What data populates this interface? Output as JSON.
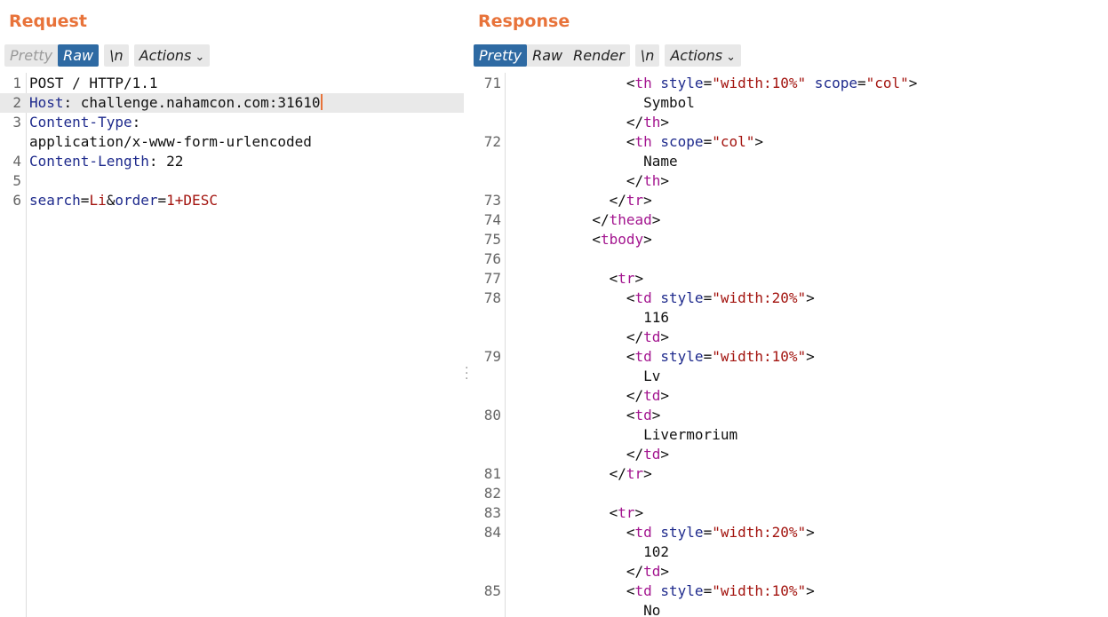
{
  "request": {
    "title": "Request",
    "toolbar": {
      "pretty": "Pretty",
      "raw": "Raw",
      "newline": "\\n",
      "actions": "Actions",
      "active": "raw"
    },
    "lines": [
      {
        "n": "1",
        "tokens": [
          {
            "t": "POST / HTTP/1.1",
            "c": "val"
          }
        ]
      },
      {
        "n": "2",
        "highlight": true,
        "caret": true,
        "tokens": [
          {
            "t": "Host",
            "c": "key"
          },
          {
            "t": ": challenge.nahamcon.com:31610",
            "c": "val"
          }
        ]
      },
      {
        "n": "3",
        "tokens": [
          {
            "t": "Content-Type",
            "c": "key"
          },
          {
            "t": ":",
            "c": "val"
          }
        ]
      },
      {
        "n": "",
        "tokens": [
          {
            "t": "application/x-www-form-urlencoded",
            "c": "val"
          }
        ]
      },
      {
        "n": "4",
        "tokens": [
          {
            "t": "Content-Length",
            "c": "key"
          },
          {
            "t": ": 22",
            "c": "val"
          }
        ]
      },
      {
        "n": "5",
        "tokens": []
      },
      {
        "n": "6",
        "tokens": [
          {
            "t": "search",
            "c": "key"
          },
          {
            "t": "=",
            "c": "val"
          },
          {
            "t": "Li",
            "c": "str"
          },
          {
            "t": "&",
            "c": "val"
          },
          {
            "t": "order",
            "c": "key"
          },
          {
            "t": "=",
            "c": "val"
          },
          {
            "t": "1+DESC",
            "c": "str"
          }
        ]
      }
    ]
  },
  "response": {
    "title": "Response",
    "toolbar": {
      "pretty": "Pretty",
      "raw": "Raw",
      "render": "Render",
      "newline": "\\n",
      "actions": "Actions",
      "active": "pretty"
    },
    "lines": [
      {
        "n": "71",
        "tokens": [
          {
            "t": "              <",
            "c": "punct"
          },
          {
            "t": "th",
            "c": "tag"
          },
          {
            "t": " style",
            "c": "attr"
          },
          {
            "t": "=",
            "c": "punct"
          },
          {
            "t": "\"width:10%\"",
            "c": "str"
          },
          {
            "t": " scope",
            "c": "attr"
          },
          {
            "t": "=",
            "c": "punct"
          },
          {
            "t": "\"col\"",
            "c": "str"
          },
          {
            "t": ">",
            "c": "punct"
          }
        ]
      },
      {
        "n": "",
        "tokens": [
          {
            "t": "                Symbol",
            "c": "val"
          }
        ]
      },
      {
        "n": "",
        "tokens": [
          {
            "t": "              </",
            "c": "punct"
          },
          {
            "t": "th",
            "c": "tag"
          },
          {
            "t": ">",
            "c": "punct"
          }
        ]
      },
      {
        "n": "72",
        "tokens": [
          {
            "t": "              <",
            "c": "punct"
          },
          {
            "t": "th",
            "c": "tag"
          },
          {
            "t": " scope",
            "c": "attr"
          },
          {
            "t": "=",
            "c": "punct"
          },
          {
            "t": "\"col\"",
            "c": "str"
          },
          {
            "t": ">",
            "c": "punct"
          }
        ]
      },
      {
        "n": "",
        "tokens": [
          {
            "t": "                Name",
            "c": "val"
          }
        ]
      },
      {
        "n": "",
        "tokens": [
          {
            "t": "              </",
            "c": "punct"
          },
          {
            "t": "th",
            "c": "tag"
          },
          {
            "t": ">",
            "c": "punct"
          }
        ]
      },
      {
        "n": "73",
        "tokens": [
          {
            "t": "            </",
            "c": "punct"
          },
          {
            "t": "tr",
            "c": "tag"
          },
          {
            "t": ">",
            "c": "punct"
          }
        ]
      },
      {
        "n": "74",
        "tokens": [
          {
            "t": "          </",
            "c": "punct"
          },
          {
            "t": "thead",
            "c": "tag"
          },
          {
            "t": ">",
            "c": "punct"
          }
        ]
      },
      {
        "n": "75",
        "tokens": [
          {
            "t": "          <",
            "c": "punct"
          },
          {
            "t": "tbody",
            "c": "tag"
          },
          {
            "t": ">",
            "c": "punct"
          }
        ]
      },
      {
        "n": "76",
        "tokens": []
      },
      {
        "n": "77",
        "tokens": [
          {
            "t": "            <",
            "c": "punct"
          },
          {
            "t": "tr",
            "c": "tag"
          },
          {
            "t": ">",
            "c": "punct"
          }
        ]
      },
      {
        "n": "78",
        "tokens": [
          {
            "t": "              <",
            "c": "punct"
          },
          {
            "t": "td",
            "c": "tag"
          },
          {
            "t": " style",
            "c": "attr"
          },
          {
            "t": "=",
            "c": "punct"
          },
          {
            "t": "\"width:20%\"",
            "c": "str"
          },
          {
            "t": ">",
            "c": "punct"
          }
        ]
      },
      {
        "n": "",
        "tokens": [
          {
            "t": "                116",
            "c": "val"
          }
        ]
      },
      {
        "n": "",
        "tokens": [
          {
            "t": "              </",
            "c": "punct"
          },
          {
            "t": "td",
            "c": "tag"
          },
          {
            "t": ">",
            "c": "punct"
          }
        ]
      },
      {
        "n": "79",
        "tokens": [
          {
            "t": "              <",
            "c": "punct"
          },
          {
            "t": "td",
            "c": "tag"
          },
          {
            "t": " style",
            "c": "attr"
          },
          {
            "t": "=",
            "c": "punct"
          },
          {
            "t": "\"width:10%\"",
            "c": "str"
          },
          {
            "t": ">",
            "c": "punct"
          }
        ]
      },
      {
        "n": "",
        "tokens": [
          {
            "t": "                Lv",
            "c": "val"
          }
        ]
      },
      {
        "n": "",
        "tokens": [
          {
            "t": "              </",
            "c": "punct"
          },
          {
            "t": "td",
            "c": "tag"
          },
          {
            "t": ">",
            "c": "punct"
          }
        ]
      },
      {
        "n": "80",
        "tokens": [
          {
            "t": "              <",
            "c": "punct"
          },
          {
            "t": "td",
            "c": "tag"
          },
          {
            "t": ">",
            "c": "punct"
          }
        ]
      },
      {
        "n": "",
        "tokens": [
          {
            "t": "                Livermorium",
            "c": "val"
          }
        ]
      },
      {
        "n": "",
        "tokens": [
          {
            "t": "              </",
            "c": "punct"
          },
          {
            "t": "td",
            "c": "tag"
          },
          {
            "t": ">",
            "c": "punct"
          }
        ]
      },
      {
        "n": "81",
        "tokens": [
          {
            "t": "            </",
            "c": "punct"
          },
          {
            "t": "tr",
            "c": "tag"
          },
          {
            "t": ">",
            "c": "punct"
          }
        ]
      },
      {
        "n": "82",
        "tokens": []
      },
      {
        "n": "83",
        "tokens": [
          {
            "t": "            <",
            "c": "punct"
          },
          {
            "t": "tr",
            "c": "tag"
          },
          {
            "t": ">",
            "c": "punct"
          }
        ]
      },
      {
        "n": "84",
        "tokens": [
          {
            "t": "              <",
            "c": "punct"
          },
          {
            "t": "td",
            "c": "tag"
          },
          {
            "t": " style",
            "c": "attr"
          },
          {
            "t": "=",
            "c": "punct"
          },
          {
            "t": "\"width:20%\"",
            "c": "str"
          },
          {
            "t": ">",
            "c": "punct"
          }
        ]
      },
      {
        "n": "",
        "tokens": [
          {
            "t": "                102",
            "c": "val"
          }
        ]
      },
      {
        "n": "",
        "tokens": [
          {
            "t": "              </",
            "c": "punct"
          },
          {
            "t": "td",
            "c": "tag"
          },
          {
            "t": ">",
            "c": "punct"
          }
        ]
      },
      {
        "n": "85",
        "tokens": [
          {
            "t": "              <",
            "c": "punct"
          },
          {
            "t": "td",
            "c": "tag"
          },
          {
            "t": " style",
            "c": "attr"
          },
          {
            "t": "=",
            "c": "punct"
          },
          {
            "t": "\"width:10%\"",
            "c": "str"
          },
          {
            "t": ">",
            "c": "punct"
          }
        ]
      },
      {
        "n": "",
        "tokens": [
          {
            "t": "                No",
            "c": "val"
          }
        ]
      }
    ]
  }
}
